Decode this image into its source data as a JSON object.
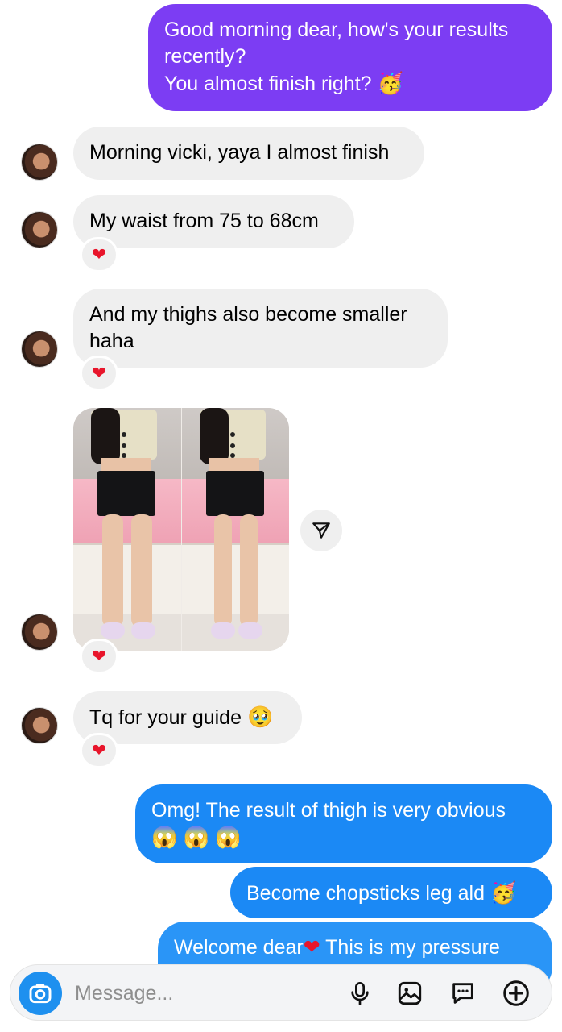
{
  "messages": {
    "m1": {
      "line1": "Good morning dear, how's your results",
      "line2": "recently?",
      "line3": "You almost finish right?",
      "emoji": "🥳"
    },
    "m2": {
      "text": "Morning vicki, yaya I almost finish"
    },
    "m3": {
      "text": "My waist from 75 to 68cm",
      "reaction": "❤"
    },
    "m4": {
      "line1": "And my thighs also become smaller",
      "line2": "haha",
      "reaction": "❤"
    },
    "m5": {
      "type": "photo",
      "reaction": "❤"
    },
    "m6": {
      "text": "Tq for your guide",
      "emoji": "🥹",
      "reaction": "❤"
    },
    "m7": {
      "line1": "Omg! The result of thigh is very obvious",
      "line2": "😱 😱 😱"
    },
    "m8": {
      "text": "Become chopsticks leg ald",
      "emoji": "🥳"
    },
    "m9": {
      "text_a": "Welcome dear",
      "heart": "❤",
      "text_b": " This is my pressure"
    }
  },
  "composer": {
    "placeholder": "Message..."
  },
  "icons": [
    "camera-icon",
    "microphone-icon",
    "gallery-icon",
    "sticker-icon",
    "add-icon",
    "share-icon",
    "heart-icon"
  ],
  "colors": {
    "purple": "#7b3ff2",
    "blue": "#1a86f5",
    "incoming": "#efefef",
    "heart": "#e8152b"
  }
}
